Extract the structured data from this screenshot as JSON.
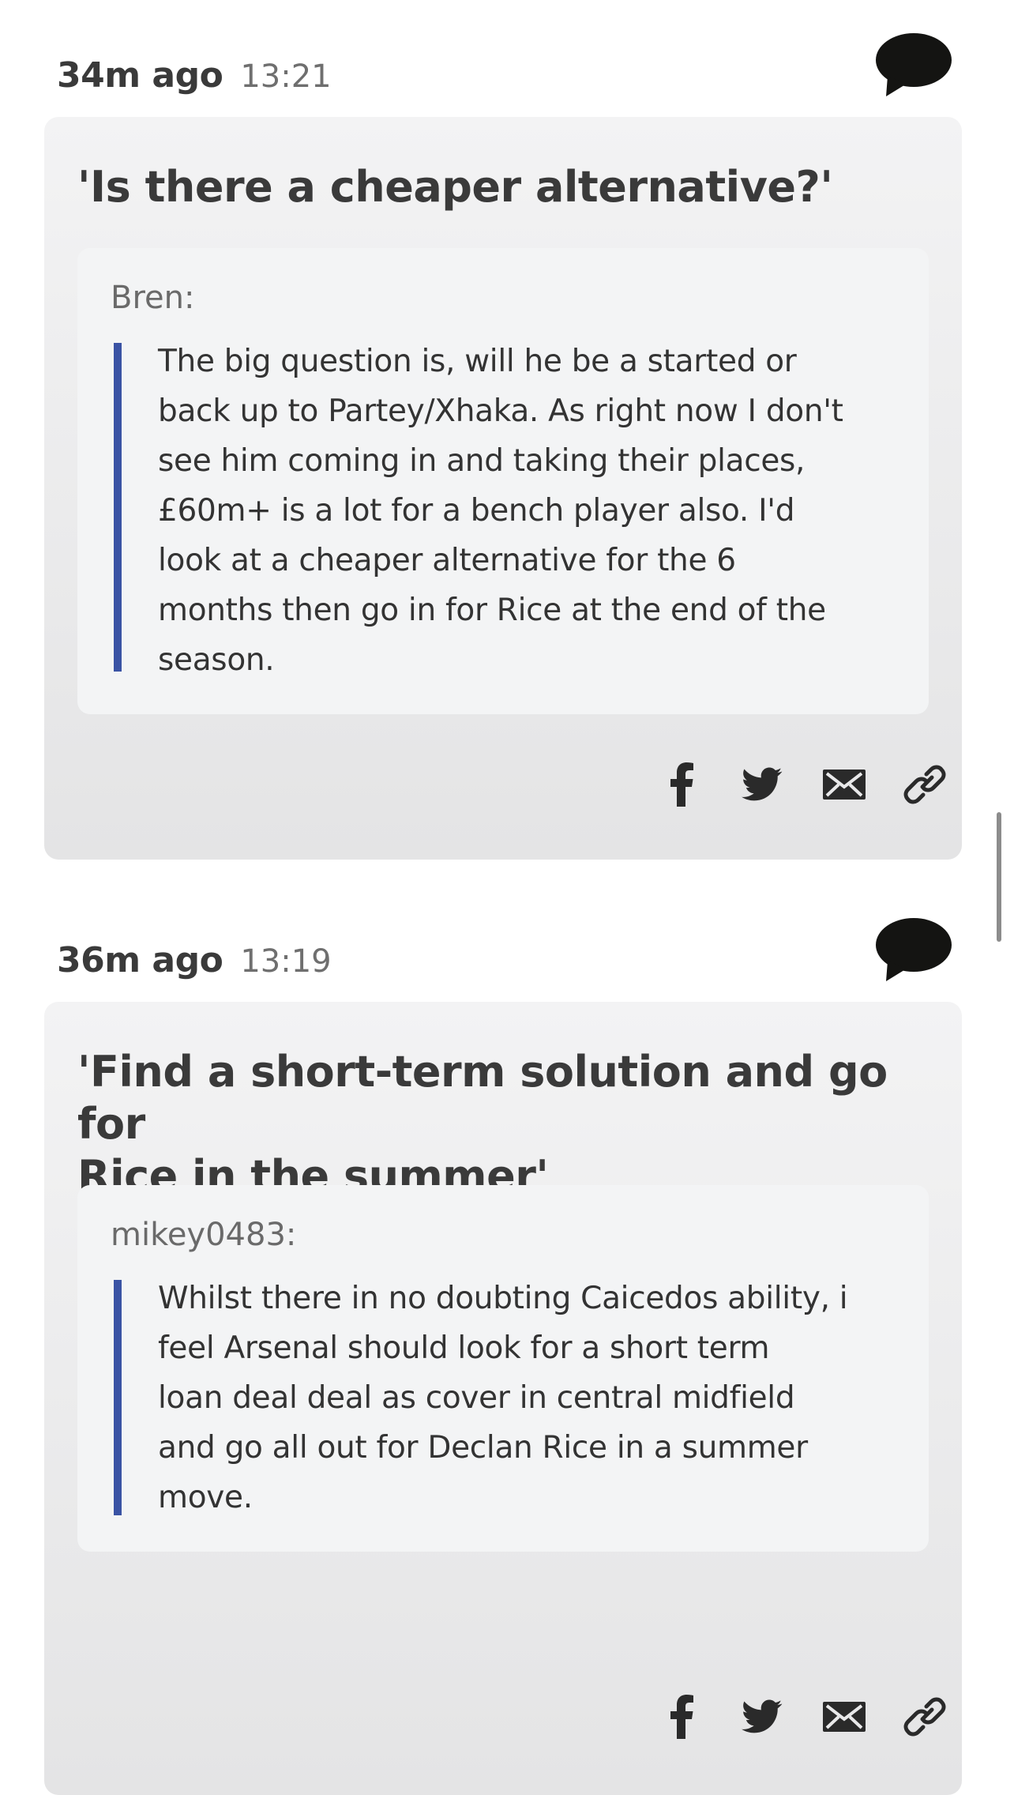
{
  "posts": [
    {
      "relative_time": "34m ago",
      "clock_time": "13:21",
      "headline": "'Is there a cheaper alternative?'",
      "quote": {
        "author": "Bren:",
        "lines": [
          "The big question is, will he be a started or",
          "back up to Partey/Xhaka. As right now I don't",
          "see him coming in and taking their places,",
          "£60m+ is a lot for a bench player also. I'd",
          "look at a cheaper alternative for the 6",
          "months then go in for Rice at the end of the",
          "season."
        ]
      }
    },
    {
      "relative_time": "36m ago",
      "clock_time": "13:19",
      "headline_lines": [
        "'Find a short-term solution and go for",
        "Rice in the summer'"
      ],
      "quote": {
        "author": "mikey0483:",
        "lines": [
          "Whilst there in no doubting Caicedos ability, i",
          "feel Arsenal should look for a short term",
          "loan deal deal as cover in central midfield",
          "and go all out for Declan Rice in a summer",
          "move."
        ]
      }
    }
  ],
  "share_icons": [
    "facebook-icon",
    "twitter-icon",
    "email-icon",
    "link-icon"
  ],
  "icons": {
    "comment": "speech-bubble-icon"
  },
  "colors": {
    "quote_bar": "#3a53a4",
    "card_top": "#f3f3f4",
    "card_bottom": "#e4e4e5",
    "quote_bg": "#f3f4f5",
    "icon": "#2a2a2a"
  }
}
